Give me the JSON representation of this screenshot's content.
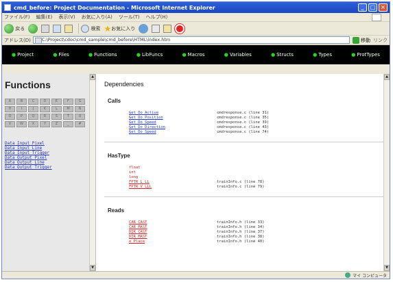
{
  "window": {
    "title": "cmd_before: Project Documentation - Microsoft Internet Explorer",
    "min": "_",
    "max": "□",
    "close": "×"
  },
  "menu": [
    "ファイル(F)",
    "編集(E)",
    "表示(V)",
    "お気に入り(A)",
    "ツール(T)",
    "ヘルプ(H)"
  ],
  "toolbar": {
    "back": "戻る",
    "search": "検索",
    "favorites": "お気に入り"
  },
  "address": {
    "label": "アドレス(D)",
    "value": "C:\\Project\\cdoc\\cmd_sample\\cmd_before\\HTML\\index.htm",
    "go": "移動",
    "links": "リンク"
  },
  "nav": [
    "Project",
    "Files",
    "Functions",
    "LibFuncs",
    "Macros",
    "Variables",
    "Structs",
    "Types",
    "ProtTypes"
  ],
  "left": {
    "heading": "Functions",
    "letters": [
      "A",
      "B",
      "C",
      "D",
      "E",
      "F",
      "G",
      "H",
      "I",
      "J",
      "K",
      "L",
      "M",
      "N",
      "O",
      "P",
      "Q",
      "R",
      "S",
      "T",
      "U",
      "V",
      "W",
      "X",
      "Y",
      "Z",
      "_",
      "#"
    ],
    "functions": [
      "Data_Input_Pixel",
      "Data_Input_Line",
      "Data_Input_Trigger",
      "Data_Output_Pixel",
      "Data_Output_Line",
      "Data_Output_Trigger"
    ]
  },
  "right": {
    "heading": "Dependencies",
    "calls": {
      "title": "Calls",
      "rows": [
        {
          "name": "Get_Do_Active",
          "loc": "cmdresponse.c (line 31)"
        },
        {
          "name": "Get_Do_Position",
          "loc": "cmdresponse.c (line 35)"
        },
        {
          "name": "Get_Do_Speed",
          "loc": "cmdresponse.c (line 39)"
        },
        {
          "name": "Get_Do_Direction",
          "loc": "cmdresponse.c (line 43)"
        },
        {
          "name": "Get_Do_Speed",
          "loc": "cmdresponse.c (line 74)"
        }
      ]
    },
    "hastype": {
      "title": "HasType",
      "rows": [
        {
          "name": "float",
          "loc": ""
        },
        {
          "name": "int",
          "loc": ""
        },
        {
          "name": "long",
          "loc": ""
        },
        {
          "name": "FPTR_L_LL",
          "loc": "trainInfo.c (line 78)"
        },
        {
          "name": "FPTR_V_LLL",
          "loc": "trainInfo.c (line 79)"
        }
      ]
    },
    "reads": {
      "title": "Reads",
      "rows": [
        {
          "name": "CAR_CAST",
          "loc": "trainInfo.h (line 33)"
        },
        {
          "name": "CAR_MAST",
          "loc": "trainInfo.h (line 34)"
        },
        {
          "name": "DIR_CAST",
          "loc": "trainInfo.h (line 37)"
        },
        {
          "name": "DIR_MAST",
          "loc": "trainInfo.h (line 38)"
        },
        {
          "name": "e_Place",
          "loc": "trainInfo.h (line 40)"
        }
      ]
    }
  },
  "status": {
    "left": "",
    "zone": "マイ コンピュータ"
  }
}
